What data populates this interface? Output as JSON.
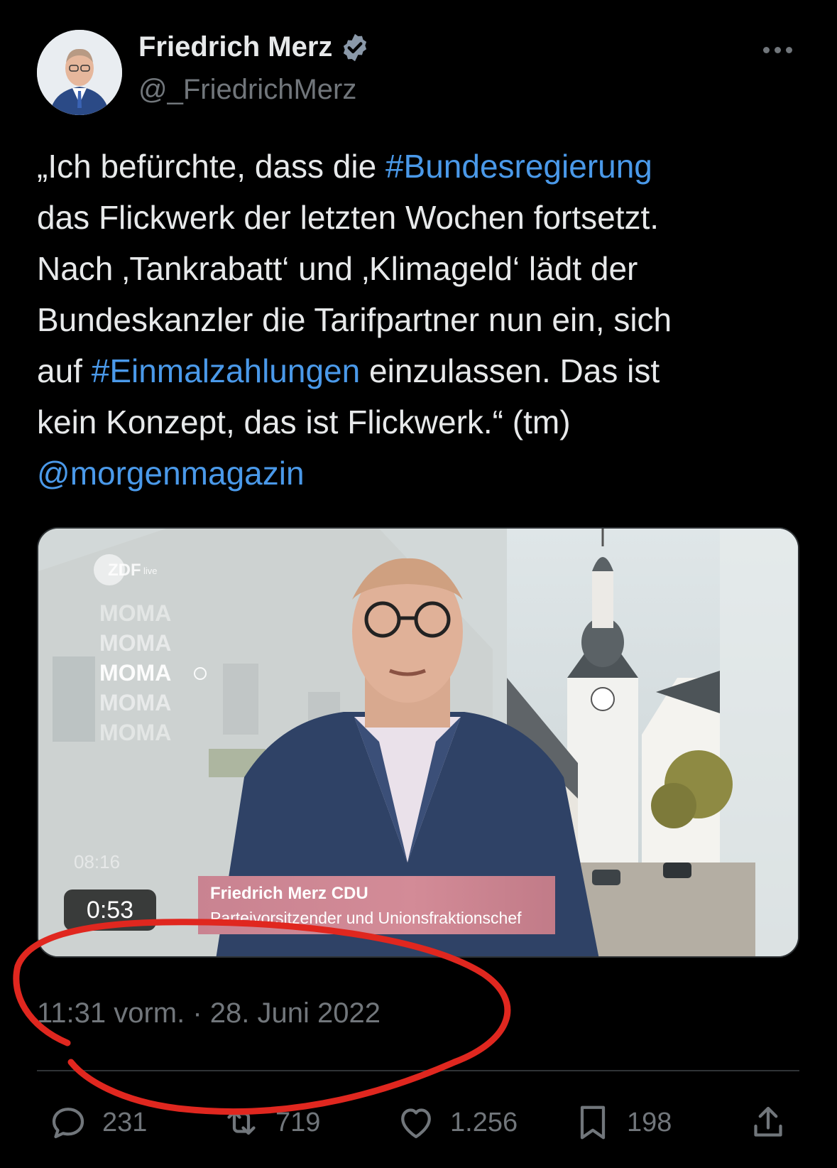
{
  "author": {
    "name": "Friedrich Merz",
    "handle": "@_FriedrichMerz",
    "verified": true,
    "avatar": "avatar-photo"
  },
  "tweet": {
    "lines": [
      [
        "„Ich befürchte, dass die ",
        "#Bundesregierung"
      ],
      [
        "das Flickwerk der letzten Wochen fortsetzt."
      ],
      [
        "Nach ‚Tankrabatt‘ und ‚Klimageld‘ lädt der"
      ],
      [
        "Bundeskanzler die Tarifpartner nun ein, sich"
      ],
      [
        "auf ",
        "#Einmalzahlungen",
        " einzulassen. Das ist"
      ],
      [
        "kein Konzept, das ist Flickwerk.“ (tm)"
      ],
      [
        "@morgenmagazin"
      ]
    ]
  },
  "video": {
    "duration": "0:53",
    "clock": "08:16",
    "channel_logo": "ZDF",
    "channel_sub": "live",
    "brand_words": [
      "MOMA",
      "MOMA",
      "MOMA",
      "MOMA",
      "MOMA"
    ],
    "lower_third_name": "Friedrich Merz  CDU",
    "lower_third_role": "Parteivorsitzender und Unionsfraktionschef"
  },
  "timestamp": "11:31 vorm. · 28. Juni 2022",
  "actions": {
    "replies": "231",
    "retweets": "719",
    "likes": "1.256",
    "bookmarks": "198"
  },
  "colors": {
    "background": "#000000",
    "text": "#e7e9ea",
    "muted": "#71767b",
    "link": "#4a99e9",
    "verified": "#8a98a8",
    "annotation": "#e0271f"
  }
}
